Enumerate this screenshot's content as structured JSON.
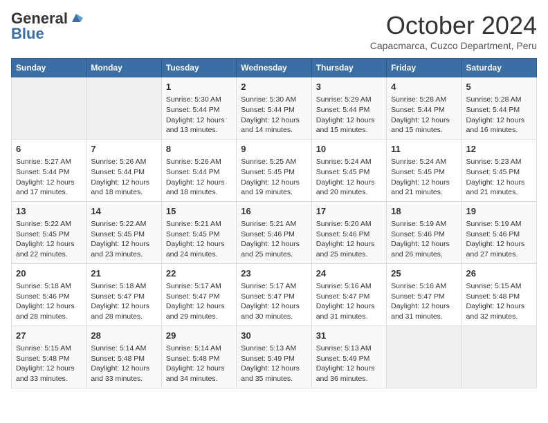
{
  "header": {
    "logo_general": "General",
    "logo_blue": "Blue",
    "month_title": "October 2024",
    "subtitle": "Capacmarca, Cuzco Department, Peru"
  },
  "days_of_week": [
    "Sunday",
    "Monday",
    "Tuesday",
    "Wednesday",
    "Thursday",
    "Friday",
    "Saturday"
  ],
  "weeks": [
    [
      {
        "day": "",
        "sunrise": "",
        "sunset": "",
        "daylight": ""
      },
      {
        "day": "",
        "sunrise": "",
        "sunset": "",
        "daylight": ""
      },
      {
        "day": "1",
        "sunrise": "Sunrise: 5:30 AM",
        "sunset": "Sunset: 5:44 PM",
        "daylight": "Daylight: 12 hours and 13 minutes."
      },
      {
        "day": "2",
        "sunrise": "Sunrise: 5:30 AM",
        "sunset": "Sunset: 5:44 PM",
        "daylight": "Daylight: 12 hours and 14 minutes."
      },
      {
        "day": "3",
        "sunrise": "Sunrise: 5:29 AM",
        "sunset": "Sunset: 5:44 PM",
        "daylight": "Daylight: 12 hours and 15 minutes."
      },
      {
        "day": "4",
        "sunrise": "Sunrise: 5:28 AM",
        "sunset": "Sunset: 5:44 PM",
        "daylight": "Daylight: 12 hours and 15 minutes."
      },
      {
        "day": "5",
        "sunrise": "Sunrise: 5:28 AM",
        "sunset": "Sunset: 5:44 PM",
        "daylight": "Daylight: 12 hours and 16 minutes."
      }
    ],
    [
      {
        "day": "6",
        "sunrise": "Sunrise: 5:27 AM",
        "sunset": "Sunset: 5:44 PM",
        "daylight": "Daylight: 12 hours and 17 minutes."
      },
      {
        "day": "7",
        "sunrise": "Sunrise: 5:26 AM",
        "sunset": "Sunset: 5:44 PM",
        "daylight": "Daylight: 12 hours and 18 minutes."
      },
      {
        "day": "8",
        "sunrise": "Sunrise: 5:26 AM",
        "sunset": "Sunset: 5:44 PM",
        "daylight": "Daylight: 12 hours and 18 minutes."
      },
      {
        "day": "9",
        "sunrise": "Sunrise: 5:25 AM",
        "sunset": "Sunset: 5:45 PM",
        "daylight": "Daylight: 12 hours and 19 minutes."
      },
      {
        "day": "10",
        "sunrise": "Sunrise: 5:24 AM",
        "sunset": "Sunset: 5:45 PM",
        "daylight": "Daylight: 12 hours and 20 minutes."
      },
      {
        "day": "11",
        "sunrise": "Sunrise: 5:24 AM",
        "sunset": "Sunset: 5:45 PM",
        "daylight": "Daylight: 12 hours and 21 minutes."
      },
      {
        "day": "12",
        "sunrise": "Sunrise: 5:23 AM",
        "sunset": "Sunset: 5:45 PM",
        "daylight": "Daylight: 12 hours and 21 minutes."
      }
    ],
    [
      {
        "day": "13",
        "sunrise": "Sunrise: 5:22 AM",
        "sunset": "Sunset: 5:45 PM",
        "daylight": "Daylight: 12 hours and 22 minutes."
      },
      {
        "day": "14",
        "sunrise": "Sunrise: 5:22 AM",
        "sunset": "Sunset: 5:45 PM",
        "daylight": "Daylight: 12 hours and 23 minutes."
      },
      {
        "day": "15",
        "sunrise": "Sunrise: 5:21 AM",
        "sunset": "Sunset: 5:45 PM",
        "daylight": "Daylight: 12 hours and 24 minutes."
      },
      {
        "day": "16",
        "sunrise": "Sunrise: 5:21 AM",
        "sunset": "Sunset: 5:46 PM",
        "daylight": "Daylight: 12 hours and 25 minutes."
      },
      {
        "day": "17",
        "sunrise": "Sunrise: 5:20 AM",
        "sunset": "Sunset: 5:46 PM",
        "daylight": "Daylight: 12 hours and 25 minutes."
      },
      {
        "day": "18",
        "sunrise": "Sunrise: 5:19 AM",
        "sunset": "Sunset: 5:46 PM",
        "daylight": "Daylight: 12 hours and 26 minutes."
      },
      {
        "day": "19",
        "sunrise": "Sunrise: 5:19 AM",
        "sunset": "Sunset: 5:46 PM",
        "daylight": "Daylight: 12 hours and 27 minutes."
      }
    ],
    [
      {
        "day": "20",
        "sunrise": "Sunrise: 5:18 AM",
        "sunset": "Sunset: 5:46 PM",
        "daylight": "Daylight: 12 hours and 28 minutes."
      },
      {
        "day": "21",
        "sunrise": "Sunrise: 5:18 AM",
        "sunset": "Sunset: 5:47 PM",
        "daylight": "Daylight: 12 hours and 28 minutes."
      },
      {
        "day": "22",
        "sunrise": "Sunrise: 5:17 AM",
        "sunset": "Sunset: 5:47 PM",
        "daylight": "Daylight: 12 hours and 29 minutes."
      },
      {
        "day": "23",
        "sunrise": "Sunrise: 5:17 AM",
        "sunset": "Sunset: 5:47 PM",
        "daylight": "Daylight: 12 hours and 30 minutes."
      },
      {
        "day": "24",
        "sunrise": "Sunrise: 5:16 AM",
        "sunset": "Sunset: 5:47 PM",
        "daylight": "Daylight: 12 hours and 31 minutes."
      },
      {
        "day": "25",
        "sunrise": "Sunrise: 5:16 AM",
        "sunset": "Sunset: 5:47 PM",
        "daylight": "Daylight: 12 hours and 31 minutes."
      },
      {
        "day": "26",
        "sunrise": "Sunrise: 5:15 AM",
        "sunset": "Sunset: 5:48 PM",
        "daylight": "Daylight: 12 hours and 32 minutes."
      }
    ],
    [
      {
        "day": "27",
        "sunrise": "Sunrise: 5:15 AM",
        "sunset": "Sunset: 5:48 PM",
        "daylight": "Daylight: 12 hours and 33 minutes."
      },
      {
        "day": "28",
        "sunrise": "Sunrise: 5:14 AM",
        "sunset": "Sunset: 5:48 PM",
        "daylight": "Daylight: 12 hours and 33 minutes."
      },
      {
        "day": "29",
        "sunrise": "Sunrise: 5:14 AM",
        "sunset": "Sunset: 5:48 PM",
        "daylight": "Daylight: 12 hours and 34 minutes."
      },
      {
        "day": "30",
        "sunrise": "Sunrise: 5:13 AM",
        "sunset": "Sunset: 5:49 PM",
        "daylight": "Daylight: 12 hours and 35 minutes."
      },
      {
        "day": "31",
        "sunrise": "Sunrise: 5:13 AM",
        "sunset": "Sunset: 5:49 PM",
        "daylight": "Daylight: 12 hours and 36 minutes."
      },
      {
        "day": "",
        "sunrise": "",
        "sunset": "",
        "daylight": ""
      },
      {
        "day": "",
        "sunrise": "",
        "sunset": "",
        "daylight": ""
      }
    ]
  ]
}
